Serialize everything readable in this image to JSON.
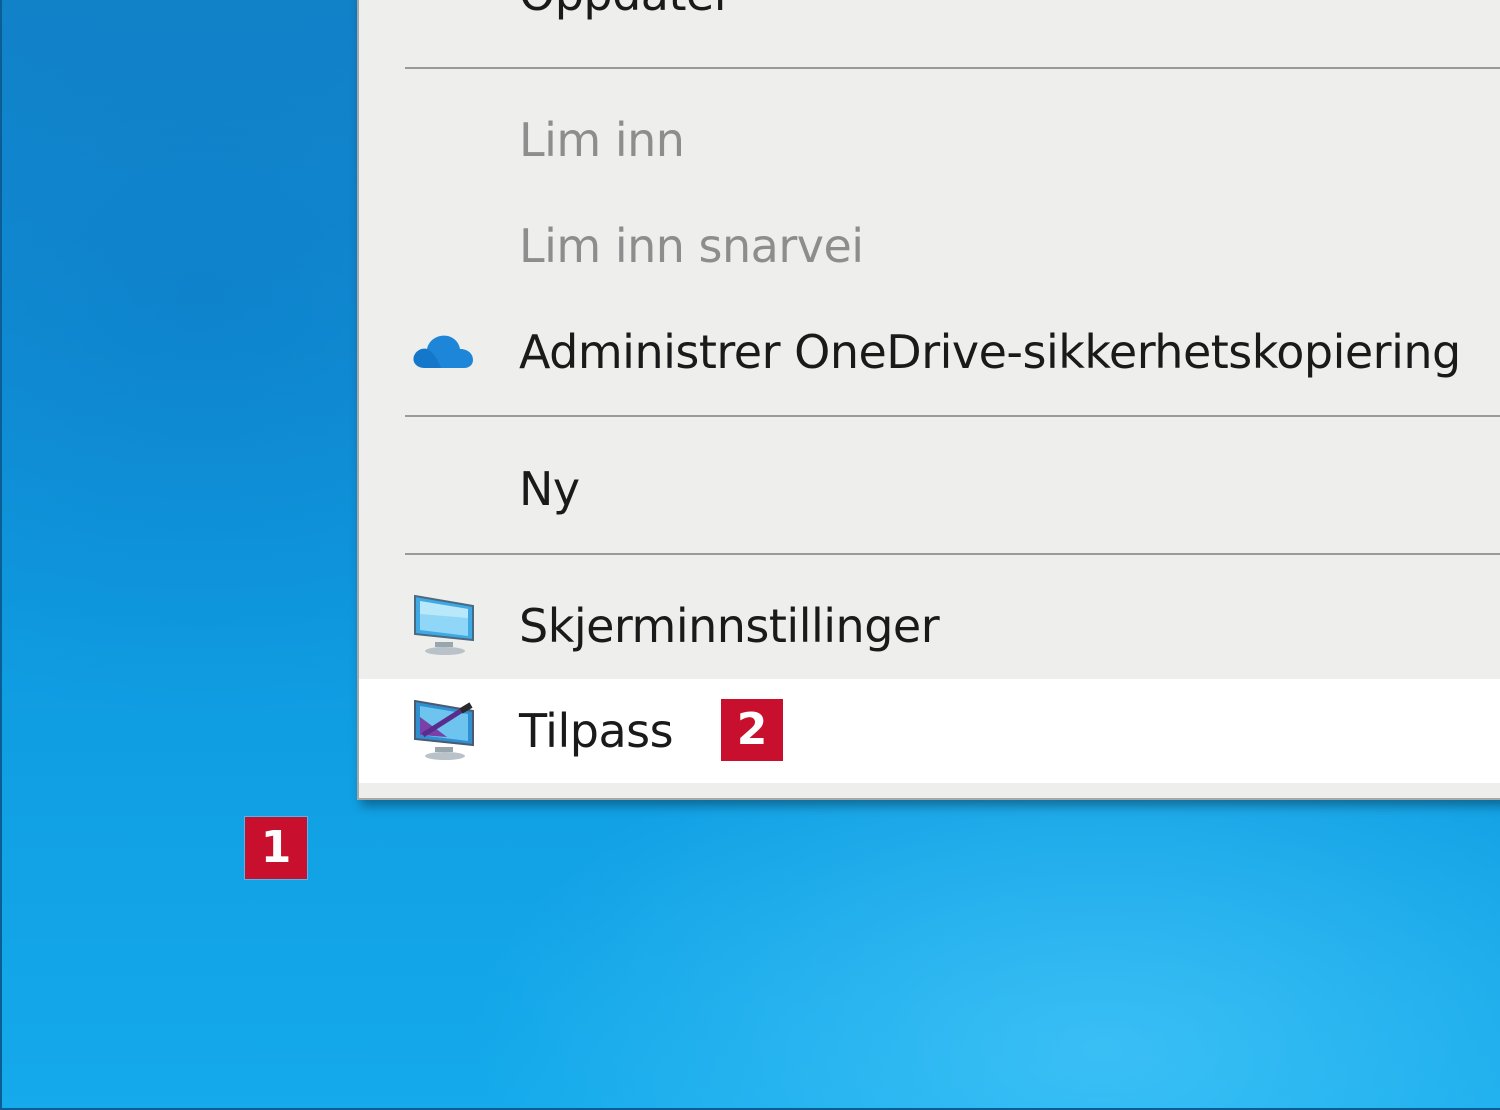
{
  "desktop": {
    "background_color": "#1a93d6",
    "badge_1": "1"
  },
  "context_menu": {
    "items": [
      {
        "label": "Oppdater",
        "disabled": false
      },
      {
        "label": "Lim inn",
        "disabled": true
      },
      {
        "label": "Lim inn snarvei",
        "disabled": true
      },
      {
        "label": "Administrer OneDrive-sikkerhetskopiering",
        "icon": "onedrive-cloud-icon",
        "disabled": false
      },
      {
        "label": "Ny",
        "disabled": false
      },
      {
        "label": "Skjerminnstillinger",
        "icon": "display-settings-icon",
        "disabled": false
      },
      {
        "label": "Tilpass",
        "icon": "personalize-icon",
        "disabled": false,
        "highlighted": true,
        "badge": "2"
      }
    ]
  },
  "colors": {
    "menu_background": "#eeeeec",
    "highlight": "#ffffff",
    "badge": "#c8102e",
    "disabled_text": "#8d8d8d"
  }
}
